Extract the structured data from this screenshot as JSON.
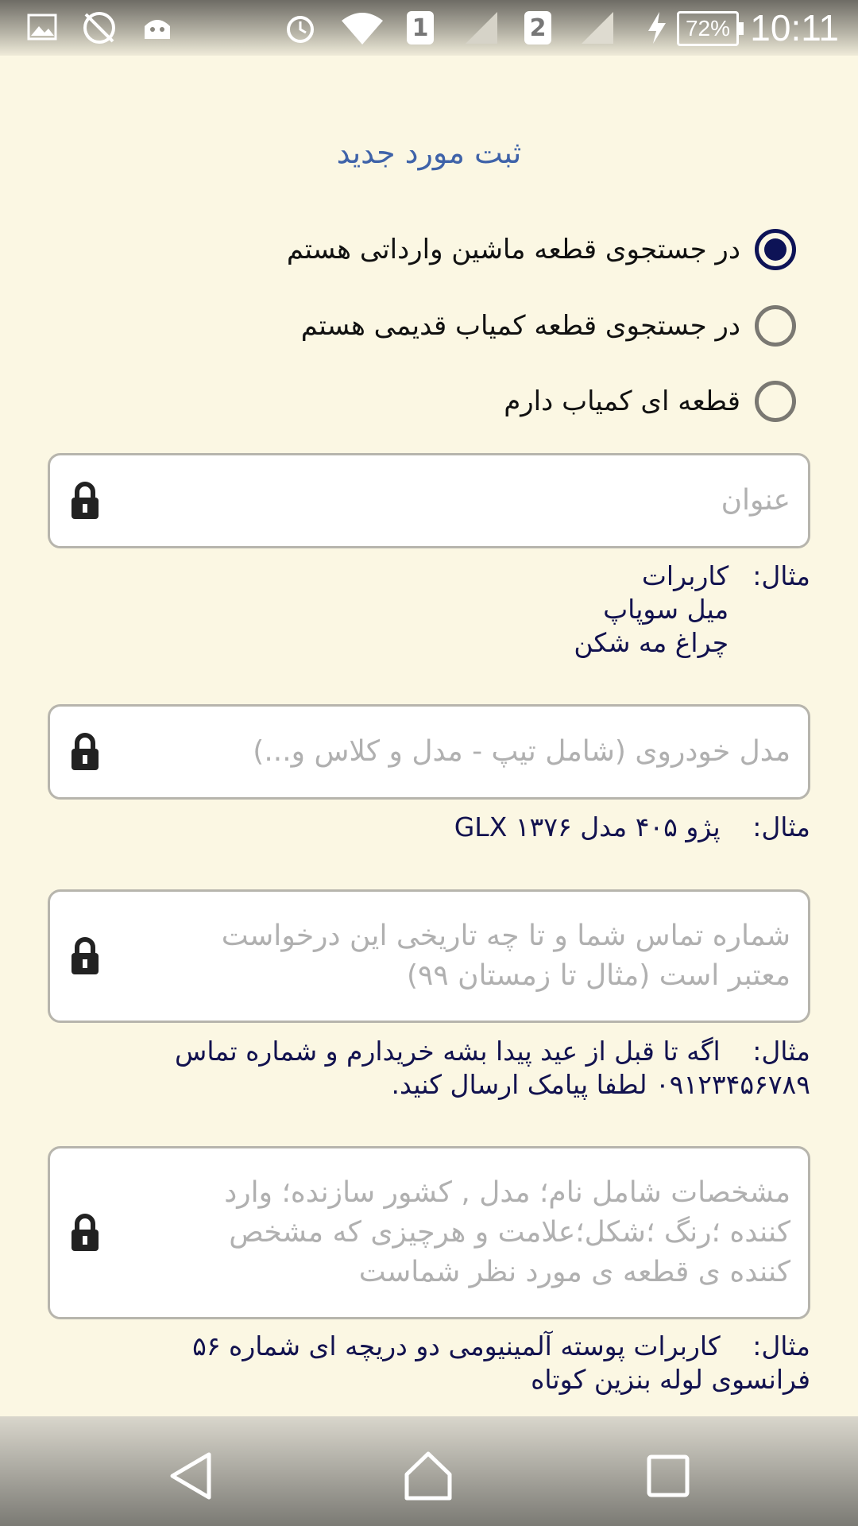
{
  "status_bar": {
    "sim1": "1",
    "sim2": "2",
    "battery": "72%",
    "time": "10:11"
  },
  "page": {
    "title": "ثبت مورد جدید"
  },
  "radio_options": [
    {
      "label": "در جستجوی قطعه ماشین وارداتی هستم",
      "selected": true
    },
    {
      "label": "در جستجوی قطعه کمیاب قدیمی هستم",
      "selected": false
    },
    {
      "label": "قطعه ای کمیاب دارم",
      "selected": false
    }
  ],
  "fields": {
    "title_field": {
      "placeholder": "عنوان"
    },
    "car_model_field": {
      "placeholder": "مدل خودروی (شامل تیپ - مدل و کلاس و...)"
    },
    "contact_field": {
      "placeholder_line1": "شماره تماس شما و تا چه تاریخی این درخواست",
      "placeholder_line2": "معتبر است (مثال تا زمستان ۹۹)"
    },
    "specs_field": {
      "placeholder_line1": "مشخصات شامل نام؛ مدل , کشور سازنده؛ وارد",
      "placeholder_line2": "کننده ؛رنگ ؛شکل؛علامت و هرچیزی که مشخص",
      "placeholder_line3": "کننده ی قطعه ی مورد نظر شماست"
    }
  },
  "examples": {
    "label": "مثال:",
    "title_example": [
      "کاربرات",
      "میل سوپاپ",
      "چراغ مه شکن"
    ],
    "car_model_example": "پژو ۴۰۵ مدل ۱۳۷۶ GLX",
    "contact_example_line1": "اگه تا قبل از عید پیدا بشه خریدارم و شماره تماس",
    "contact_example_line2": "۰۹۱۲۳۴۵۶۷۸۹ لطفا پیامک ارسال کنید.",
    "specs_example_line1": "کاربرات پوسته آلمینیومی دو دریچه ای شماره ۵۶",
    "specs_example_line2": "فرانسوی لوله بنزین کوتاه"
  },
  "nav_bar": {
    "back_icon": "back-triangle-icon",
    "home_icon": "home-icon",
    "recents_icon": "recents-square-icon"
  }
}
